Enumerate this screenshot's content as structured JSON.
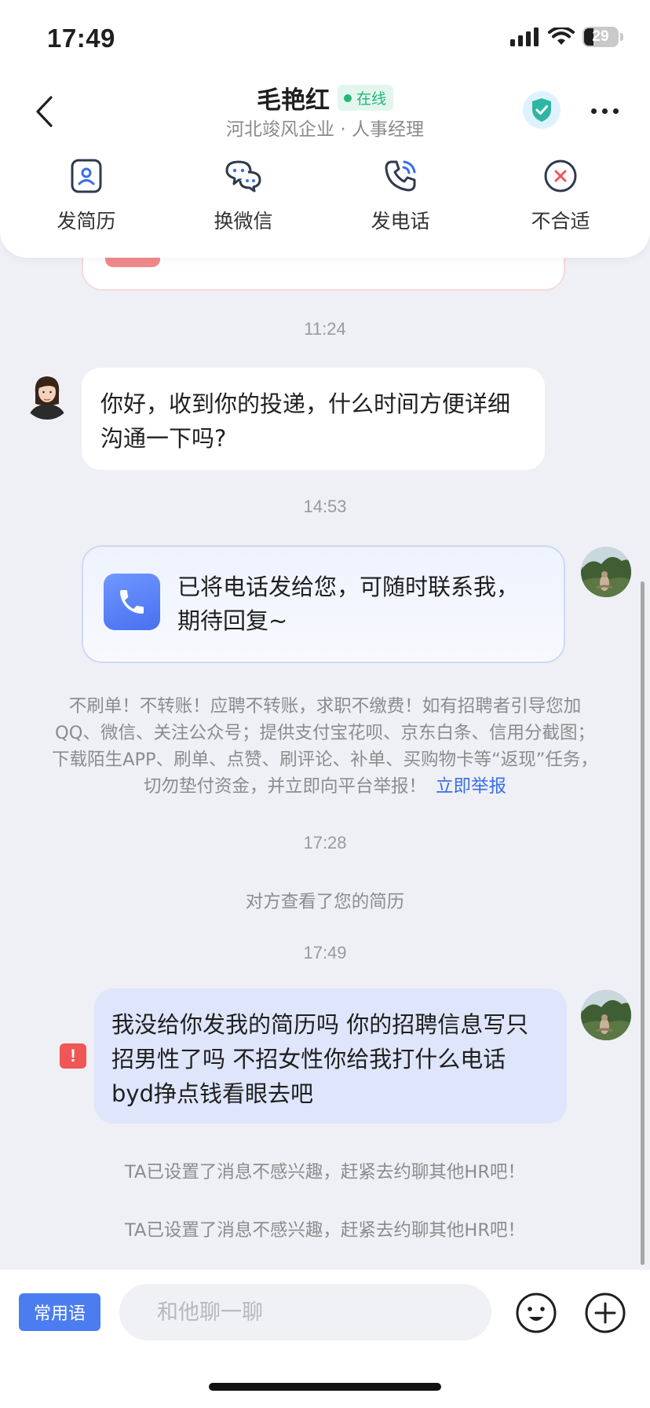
{
  "status_bar": {
    "time": "17:49",
    "battery": "29",
    "battery_level": 0.29
  },
  "header": {
    "name": "毛艳红",
    "online_label": "在线",
    "subtitle": "河北竣风企业 · 人事经理",
    "actions": [
      {
        "label": "发简历",
        "icon": "resume-icon"
      },
      {
        "label": "换微信",
        "icon": "wechat-icon"
      },
      {
        "label": "发电话",
        "icon": "phone-icon"
      },
      {
        "label": "不合适",
        "icon": "close-circle-icon"
      }
    ]
  },
  "messages": {
    "time_1": "11:24",
    "hr_message": "你好，收到你的投递，什么时间方便详细沟通一下吗?",
    "time_2": "14:53",
    "phone_card_text": "已将电话发给您，可随时联系我，期待回复~",
    "warning_text": "不刷单！不转账！应聘不转账，求职不缴费！如有招聘者引导您加QQ、微信、关注公众号；提供支付宝花呗、京东白条、信用分截图；下载陌生APP、刷单、点赞、刷评论、补单、买购物卡等“返现”任务，切勿垫付资金，并立即向平台举报！",
    "report_link": "立即举报",
    "time_3": "17:28",
    "viewed_note": "对方查看了您的简历",
    "time_4": "17:49",
    "user_message": "我没给你发我的简历吗 你的招聘信息写只招男性了吗 不招女性你给我打什么电话 byd挣点钱看眼去吧",
    "error_mark": "!",
    "system_note_1": "TA已设置了消息不感兴趣，赶紧去约聊其他HR吧！",
    "system_note_2": "TA已设置了消息不感兴趣，赶紧去约聊其他HR吧！"
  },
  "input_bar": {
    "phrases_label": "常用语",
    "placeholder": "和他聊一聊"
  },
  "colors": {
    "accent": "#4b7df1",
    "online": "#26b57a",
    "error": "#f05656",
    "self_bubble": "#dfe6fb"
  }
}
